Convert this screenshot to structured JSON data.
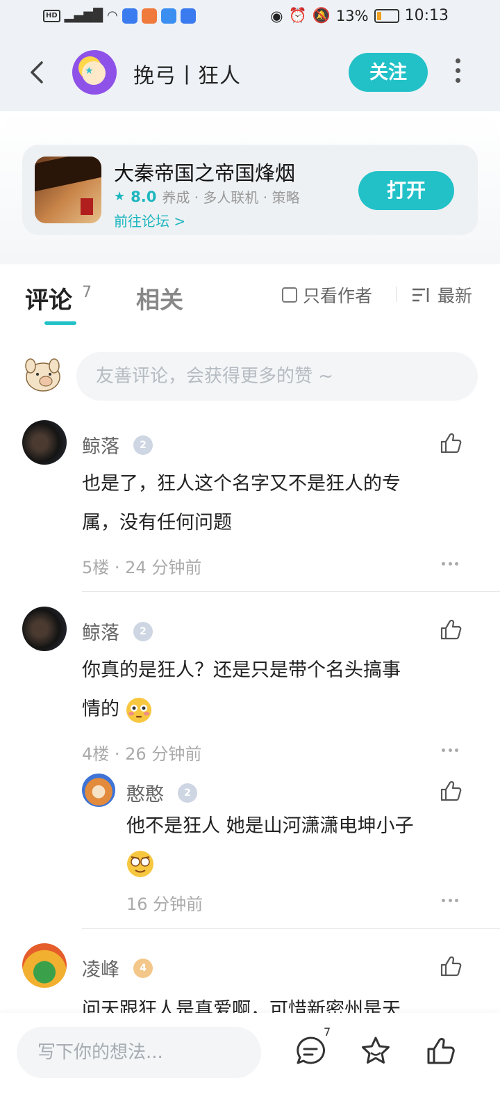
{
  "status_bar": {
    "left": "HD 5G",
    "battery": "13%",
    "time": "10:13"
  },
  "header": {
    "title": "挽弓丨狂人",
    "follow_label": "关注"
  },
  "game_card": {
    "name": "大秦帝国之帝国烽烟",
    "score": "8.0",
    "tags": "养成 · 多人联机 · 策略",
    "forum_link": "前往论坛 >",
    "open_label": "打开"
  },
  "tabs": {
    "comment_label": "评论",
    "comment_count": "7",
    "related_label": "相关",
    "only_author_label": "只看作者",
    "sort_label": "最新"
  },
  "comment_input": {
    "placeholder": "友善评论，会获得更多的赞 ~"
  },
  "comments": [
    {
      "name": "鲸落",
      "level": "2",
      "text_line1": "也是了，狂人这个名字又不是狂人的专",
      "text_line2": "属，没有任何问题",
      "footer": "5楼 · 24 分钟前"
    },
    {
      "name": "鲸落",
      "level": "2",
      "text_line1": "你真的是狂人？还是只是带个名头搞事",
      "text_line2": "情的",
      "footer": "4楼 · 26 分钟前",
      "reply": {
        "name": "憨憨",
        "level": "2",
        "text_line1": "他不是狂人 她是山河潇潇电坤小子",
        "footer": "16 分钟前"
      }
    },
    {
      "name": "凌峰",
      "level": "4",
      "text_line1": "问天跟狂人是真爱啊，可惜新密州是天"
    }
  ],
  "bottom_bar": {
    "placeholder": "写下你的想法...",
    "comment_count": "7"
  },
  "colors": {
    "accent": "#22c1c8",
    "header_bg": "#eef2f6"
  }
}
